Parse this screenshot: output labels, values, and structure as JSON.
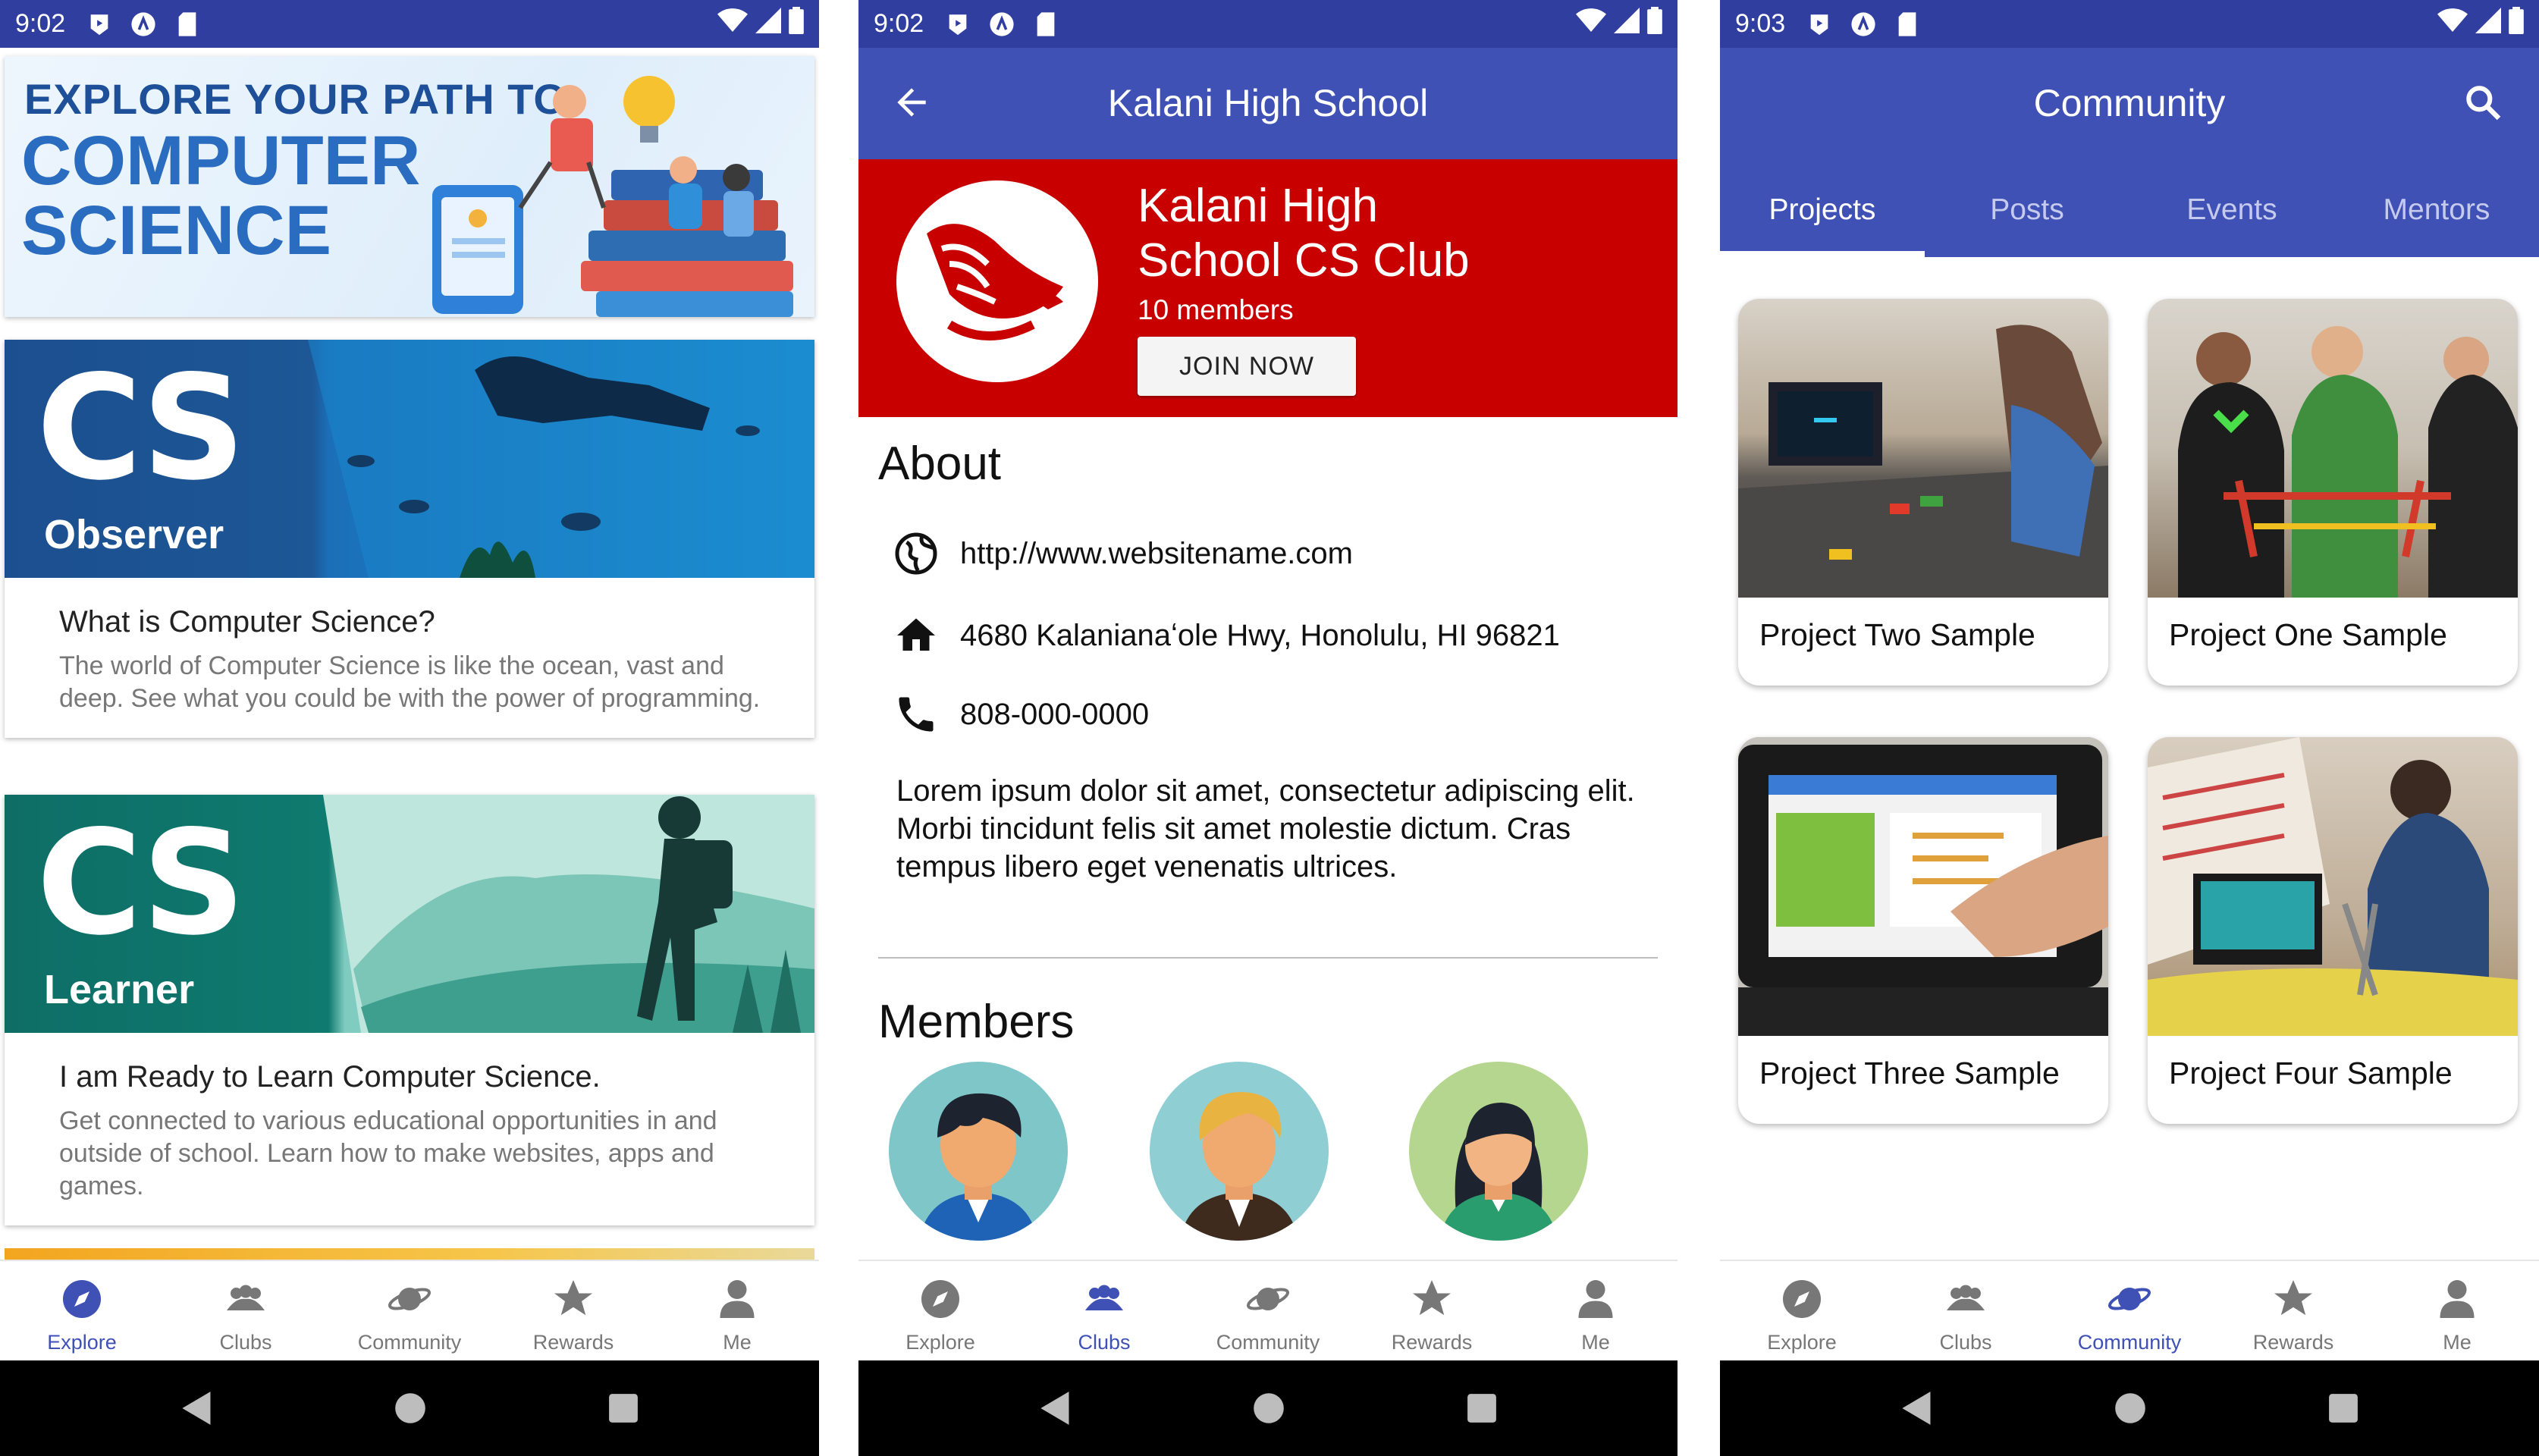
{
  "screens": [
    {
      "status": {
        "time": "9:02"
      },
      "banner": {
        "line1": "EXPLORE YOUR PATH TO",
        "line2": "COMPUTER",
        "line3": "SCIENCE"
      },
      "cards": [
        {
          "hero_title": "CS",
          "hero_sub": "Observer",
          "title": "What is Computer Science?",
          "desc": "The world of Computer Science is like the ocean, vast and deep. See what you could be with the power of programming."
        },
        {
          "hero_title": "CS",
          "hero_sub": "Learner",
          "title": "I am Ready to Learn Computer Science.",
          "desc": "Get connected to various educational opportunities in and outside of school. Learn how to make websites, apps and games."
        }
      ],
      "nav_active": "Explore"
    },
    {
      "status": {
        "time": "9:02"
      },
      "app_bar_title": "Kalani High School",
      "club": {
        "name_line1": "Kalani High",
        "name_line2": "School CS Club",
        "members": "10 members",
        "join_label": "JOIN NOW"
      },
      "about": {
        "heading": "About",
        "website": "http://www.websitename.com",
        "address": "4680 Kalanianaʻole Hwy, Honolulu, HI 96821",
        "phone": "808-000-0000",
        "text": "Lorem ipsum dolor sit amet, consectetur adipiscing elit. Morbi tincidunt felis sit amet molestie dictum. Cras tempus libero eget venenatis ultrices."
      },
      "members_heading": "Members",
      "nav_active": "Clubs"
    },
    {
      "status": {
        "time": "9:03"
      },
      "app_bar_title": "Community",
      "tabs": [
        "Projects",
        "Posts",
        "Events",
        "Mentors"
      ],
      "active_tab": "Projects",
      "projects": [
        "Project Two Sample",
        "Project One Sample",
        "Project Three Sample",
        "Project Four Sample"
      ],
      "nav_active": "Community"
    }
  ],
  "nav_labels": {
    "explore": "Explore",
    "clubs": "Clubs",
    "community": "Community",
    "rewards": "Rewards",
    "me": "Me"
  },
  "colors": {
    "primary": "#3f51b5",
    "status_bar": "#303f9f",
    "club_red": "#c80000",
    "nav_active": "#3f51b5",
    "nav_inactive": "#777777"
  },
  "icons": [
    "explore-compass-icon",
    "clubs-people-icon",
    "community-planet-icon",
    "rewards-star-icon",
    "me-person-icon",
    "back-arrow-icon",
    "search-icon",
    "globe-icon",
    "home-icon",
    "phone-icon"
  ]
}
